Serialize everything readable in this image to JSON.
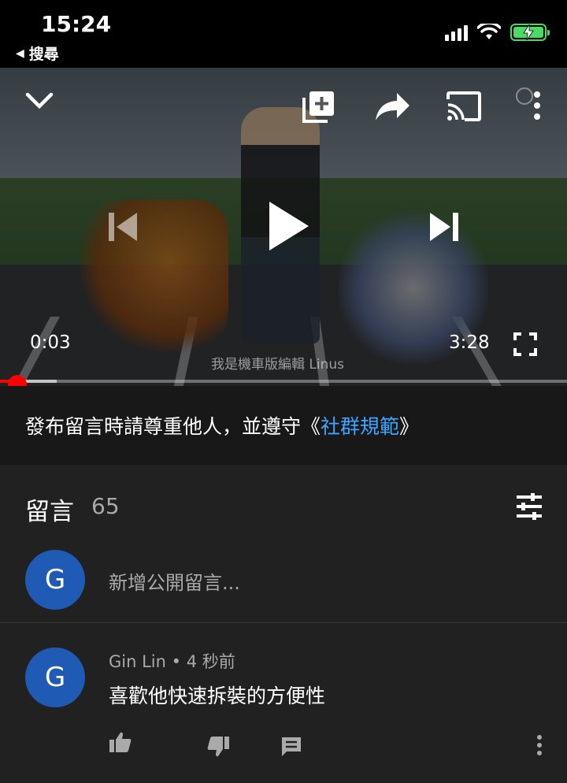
{
  "status_bar": {
    "time": "15:24",
    "back_label": "搜尋"
  },
  "player": {
    "current_time": "0:03",
    "duration": "3:28",
    "watermark": "我是機車版編輯 Linus",
    "progress_fraction": 0.015,
    "buffered_fraction": 0.1
  },
  "guideline": {
    "text_before": "發布留言時請尊重他人，並遵守《",
    "link_text": "社群規範",
    "text_after": "》"
  },
  "comments": {
    "title": "留言",
    "count": "65",
    "add_placeholder": "新增公開留言...",
    "user_avatar_letter": "G",
    "items": [
      {
        "avatar_letter": "G",
        "author": "Gin Lin",
        "separator": " • ",
        "time": "4 秒前",
        "text": "喜歡他快速拆裝的方便性"
      }
    ]
  },
  "colors": {
    "accent_link": "#3ea6ff",
    "progress_red": "#ff0000",
    "avatar_blue": "#1f5bb5",
    "battery_green": "#4cd964"
  },
  "icons": [
    "chevron-down-icon",
    "add-to-queue-icon",
    "share-icon",
    "cast-icon",
    "more-vert-icon",
    "previous-icon",
    "play-icon",
    "next-icon",
    "fullscreen-icon",
    "sort-icon",
    "thumb-up-icon",
    "thumb-down-icon",
    "reply-icon"
  ]
}
